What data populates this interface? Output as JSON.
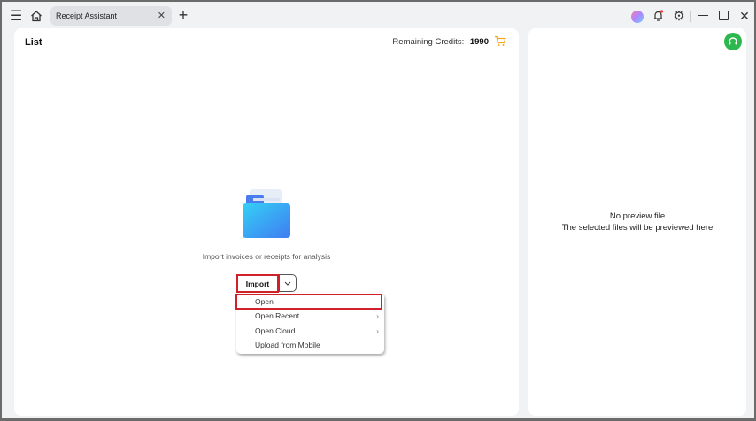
{
  "titlebar": {
    "tab_label": "Receipt Assistant"
  },
  "list_panel": {
    "title": "List",
    "credits_label": "Remaining Credits:",
    "credits_value": "1990",
    "empty_hint": "Import invoices or receipts for analysis",
    "import_label": "Import",
    "menu": [
      {
        "label": "Open"
      },
      {
        "label": "Open Recent"
      },
      {
        "label": "Open Cloud"
      },
      {
        "label": "Upload from Mobile"
      }
    ]
  },
  "preview_panel": {
    "line1": "No preview file",
    "line2": "The selected files will be previewed here"
  },
  "colors": {
    "accent": "#f5a623",
    "highlight": "#d0202a",
    "support": "#2db84d"
  }
}
